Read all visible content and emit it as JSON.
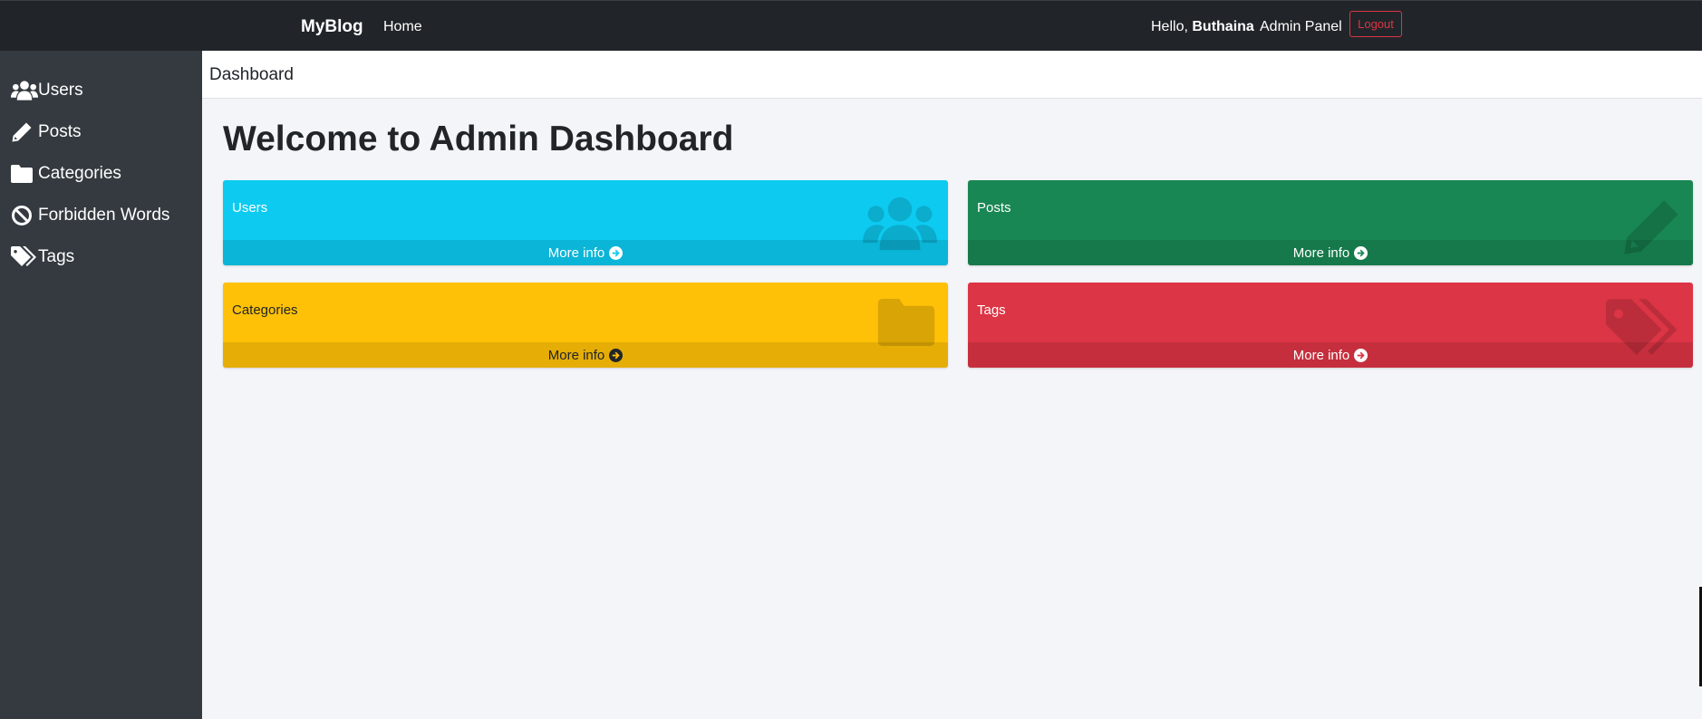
{
  "navbar": {
    "brand": "MyBlog",
    "home": "Home",
    "hello_prefix": "Hello,",
    "user_name": "Buthaina",
    "admin_panel": "Admin Panel",
    "logout": "Logout"
  },
  "sidebar": {
    "items": [
      {
        "label": "Users",
        "icon": "users-icon"
      },
      {
        "label": "Posts",
        "icon": "pencil-icon"
      },
      {
        "label": "Categories",
        "icon": "folder-icon"
      },
      {
        "label": "Forbidden Words",
        "icon": "ban-icon"
      },
      {
        "label": "Tags",
        "icon": "tags-icon"
      }
    ]
  },
  "breadcrumb": "Dashboard",
  "page_title": "Welcome to Admin Dashboard",
  "boxes": [
    {
      "label": "Users",
      "more": "More info",
      "color": "#0dcaf0",
      "icon": "users-icon"
    },
    {
      "label": "Posts",
      "more": "More info",
      "color": "#198754",
      "icon": "pencil-icon"
    },
    {
      "label": "Categories",
      "more": "More info",
      "color": "#ffc107",
      "icon": "folder-icon"
    },
    {
      "label": "Tags",
      "more": "More info",
      "color": "#dc3545",
      "icon": "tags-icon"
    }
  ]
}
